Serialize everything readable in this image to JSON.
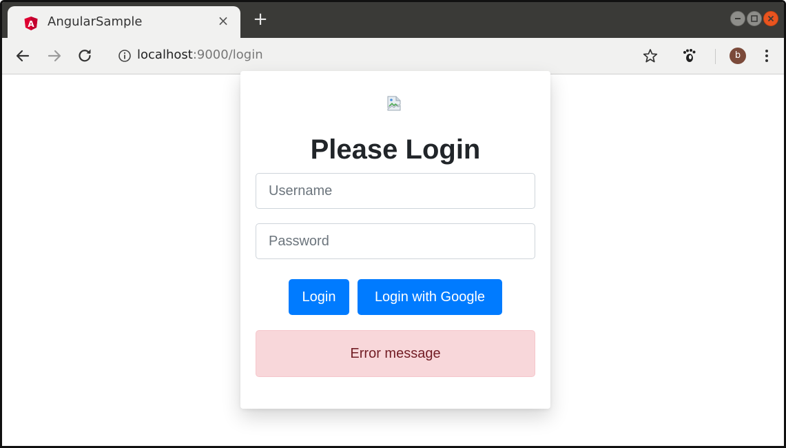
{
  "browser": {
    "tab": {
      "title": "AngularSample",
      "close_glyph": "×",
      "favicon": "angular-icon",
      "favicon_letter": "A"
    },
    "new_tab_glyph": "+",
    "url": {
      "host": "localhost",
      "path": ":9000/login"
    },
    "profile_initial": "b",
    "colors": {
      "titlebar": "#3a3a37",
      "toolbar": "#f1f1f0",
      "window_close": "#e9541f",
      "angular_red": "#dd0031"
    }
  },
  "login": {
    "title": "Please Login",
    "username_placeholder": "Username",
    "password_placeholder": "Password",
    "login_button": "Login",
    "google_button": "Login with Google",
    "error_message": "Error message",
    "colors": {
      "primary": "#007bff",
      "alert_bg": "#f8d7da",
      "alert_text": "#721c24"
    }
  }
}
